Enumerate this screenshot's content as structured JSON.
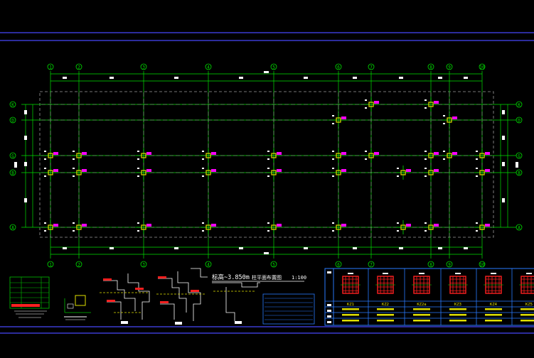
{
  "drawing": {
    "title": "标高~3.850m",
    "subtitle": "柱平面布置图",
    "scale": "1:100"
  },
  "grid_axes_horizontal": [
    "1",
    "2",
    "3",
    "4",
    "5",
    "6",
    "7",
    "8",
    "9",
    "10"
  ],
  "grid_axes_vertical": [
    "K",
    "D",
    "G",
    "B",
    "A"
  ],
  "column_table": {
    "headers": [
      "KZ1",
      "KZ2",
      "KZ2a",
      "KZ3",
      "KZ4",
      "KZ5"
    ]
  },
  "colors": {
    "background": "#000000",
    "grid_line": "#00e000",
    "axis_dash": "#9a9a9a",
    "column_mark": "#ff00ff",
    "column_body": "#e0e000",
    "rebar": "#ff2020",
    "frame": "#3b3bd0",
    "text_white": "#ffffff",
    "table_blue": "#2a7bff"
  }
}
